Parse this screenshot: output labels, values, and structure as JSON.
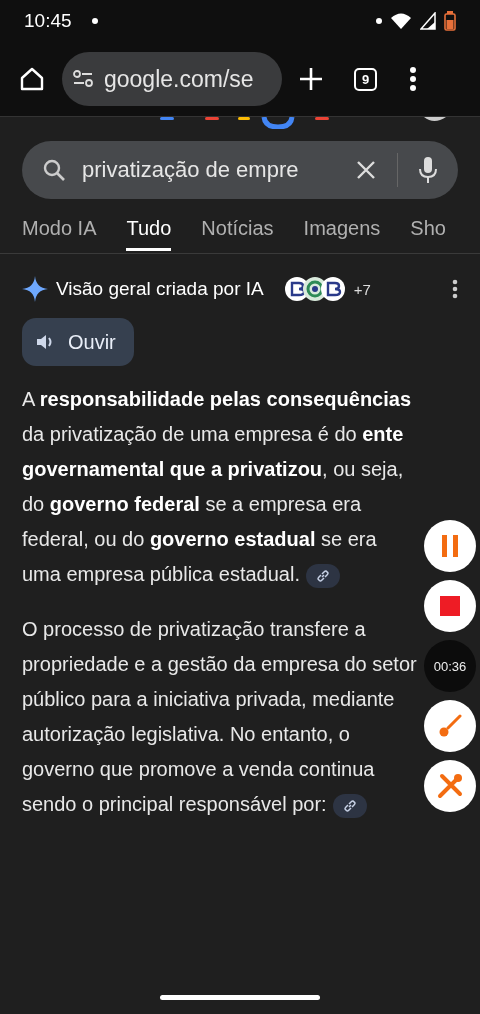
{
  "status_bar": {
    "time": "10:45"
  },
  "browser": {
    "url": "google.com/se",
    "tab_count": "9"
  },
  "search": {
    "value": "privatização de empre"
  },
  "tabs": [
    {
      "label": "Modo IA",
      "selected": false
    },
    {
      "label": "Tudo",
      "selected": true
    },
    {
      "label": "Notícias",
      "selected": false
    },
    {
      "label": "Imagens",
      "selected": false
    },
    {
      "label": "Sho",
      "selected": false
    }
  ],
  "ai_overview": {
    "title": "Visão geral criada por IA",
    "more_sources": "+7",
    "listen_button": "Ouvir",
    "paragraphs": [
      {
        "text": "A **responsabilidade pelas consequências** da privatização de uma empresa é do **ente governamental que a privatizou**, ou seja, do **governo federal** se a empresa era federal, ou do **governo estadual** se era uma empresa pública estadual.",
        "link": true
      },
      {
        "text": "O processo de privatização transfere a propriedade e a gestão da empresa do setor público para a iniciativa privada, mediante autorização legislativa. No entanto, o governo que promove a venda continua sendo o principal responsável por:",
        "link": true
      }
    ]
  },
  "recorder": {
    "timer": "00:36"
  }
}
